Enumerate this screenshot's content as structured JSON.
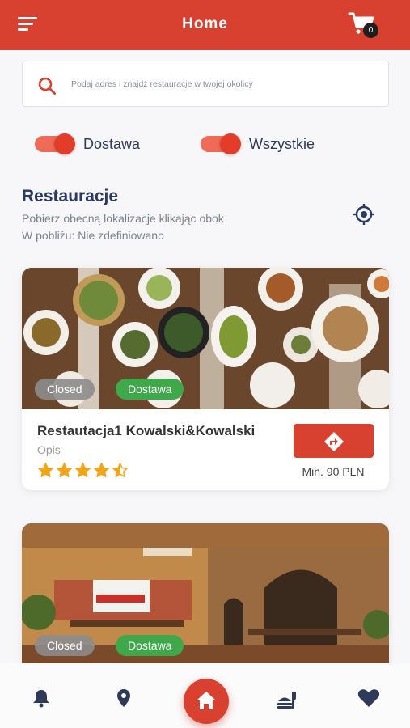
{
  "header": {
    "title": "Home",
    "cart_count": "0"
  },
  "search": {
    "placeholder": "Podaj adres i znajdź restauracje w twojej okolicy"
  },
  "filters": [
    {
      "label": "Dostawa",
      "on": true
    },
    {
      "label": "Wszystkie",
      "on": true
    }
  ],
  "section": {
    "title": "Restauracje",
    "hint": "Pobierz obecną lokalizacje klikając obok",
    "nearby": "W pobliżu:  Nie zdefiniowano"
  },
  "restaurants": [
    {
      "status": "Closed",
      "delivery": "Dostawa",
      "name": "Restautacja1 Kowalski&Kowalski",
      "description": "Opis",
      "rating": 4.5,
      "min_order": "Min. 90 PLN"
    },
    {
      "status": "Closed",
      "delivery": "Dostawa"
    }
  ],
  "icons": {
    "menu": "menu-icon",
    "cart": "cart-icon",
    "search": "search-icon",
    "locate": "crosshair-icon",
    "route": "directions-icon",
    "notifications": "bell-icon",
    "map": "map-pin-icon",
    "home": "home-icon",
    "food": "food-icon",
    "favorites": "heart-icon"
  },
  "colors": {
    "brand": "#d8412f",
    "toggle_track": "#ef6a57",
    "delivery_badge": "#3fa84a",
    "closed_badge": "#8c8c8c",
    "star": "#f0a51b",
    "heading": "#2c3a63"
  }
}
